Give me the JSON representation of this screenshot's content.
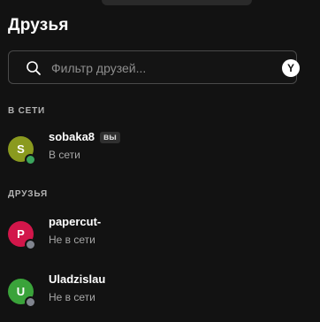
{
  "title": "Друзья",
  "search": {
    "placeholder": "Фильтр друзей...",
    "value": "",
    "shortcut": "Y"
  },
  "sections": {
    "online": {
      "header": "В СЕТИ",
      "items": [
        {
          "initial": "S",
          "name": "sobaka8",
          "badge": "вы",
          "status": "В сети",
          "avatar_color": "#8a9a1f",
          "status_color": "#3ba55d"
        }
      ]
    },
    "friends": {
      "header": "ДРУЗЬЯ",
      "items": [
        {
          "initial": "P",
          "name": "papercut-",
          "status": "Не в сети",
          "avatar_color": "#d2164a",
          "status_color": "#80848e"
        },
        {
          "initial": "U",
          "name": "Uladzislau",
          "status": "Не в сети",
          "avatar_color": "#3aa33a",
          "status_color": "#80848e"
        }
      ]
    }
  }
}
